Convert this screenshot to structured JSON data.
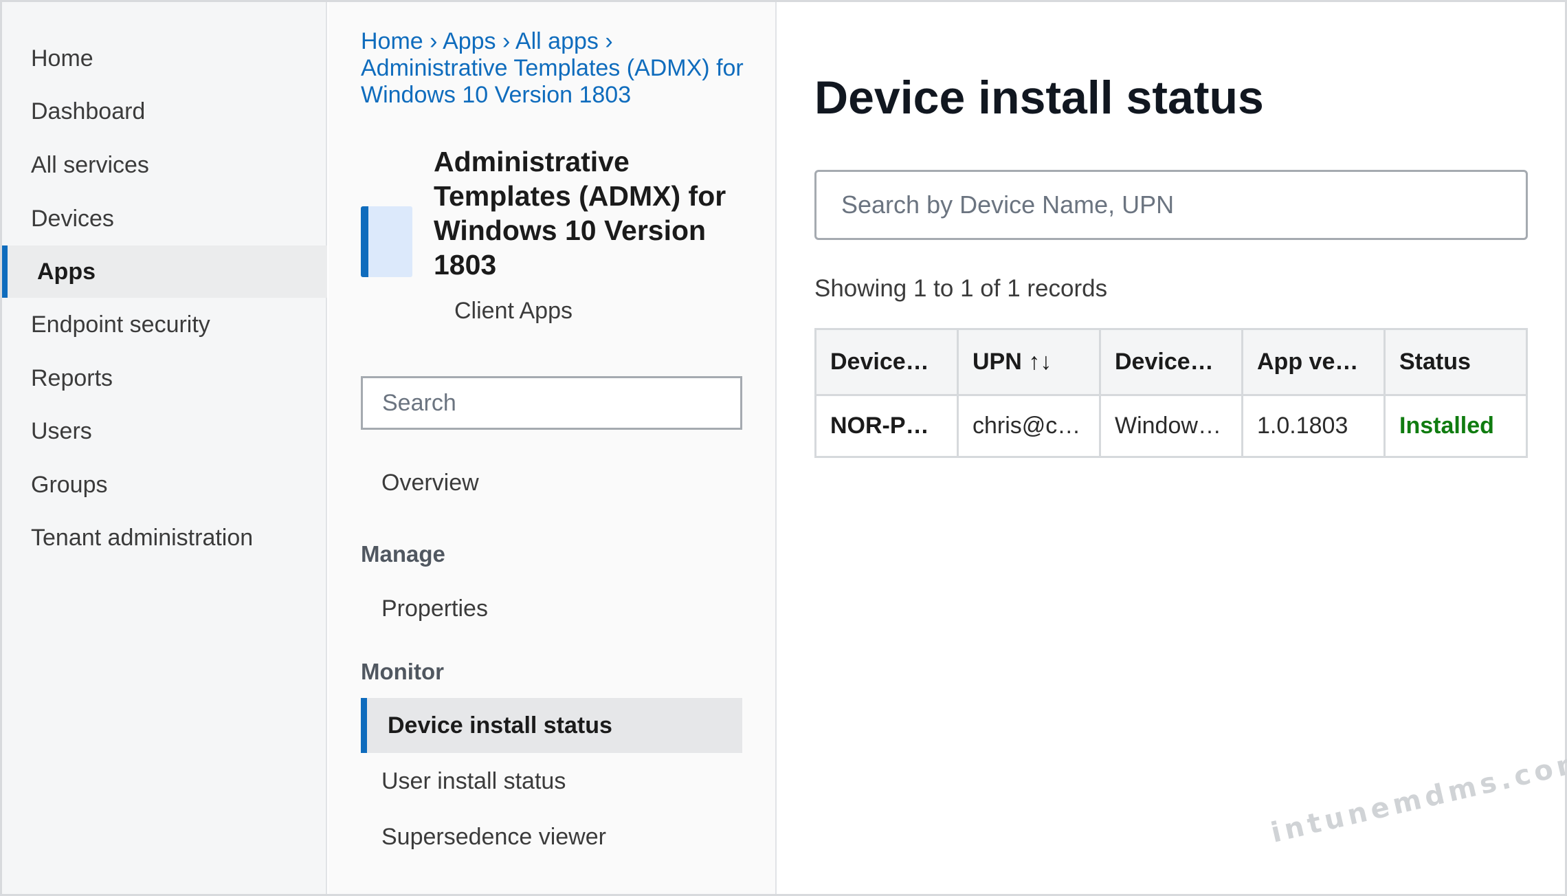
{
  "nav": {
    "items": [
      {
        "label": "Home"
      },
      {
        "label": "Dashboard"
      },
      {
        "label": "All services"
      },
      {
        "label": "Devices"
      },
      {
        "label": "Apps",
        "active": true
      },
      {
        "label": "Endpoint security"
      },
      {
        "label": "Reports"
      },
      {
        "label": "Users"
      },
      {
        "label": "Groups"
      },
      {
        "label": "Tenant administration"
      }
    ]
  },
  "breadcrumb": {
    "items": [
      "Home",
      "Apps",
      "All apps",
      "Administrative Templates (ADMX) for Windows 10 Version 1803"
    ],
    "separator": "›"
  },
  "app": {
    "title": "Administrative Templates (ADMX) for Windows 10 Version 1803",
    "subtitle": "Client Apps",
    "icon": "app-tile-icon"
  },
  "blade": {
    "search_placeholder": "Search",
    "overview": "Overview",
    "manage_header": "Manage",
    "properties": "Properties",
    "monitor_header": "Monitor",
    "device_install_status": "Device install status",
    "user_install_status": "User install status",
    "supersedence_viewer": "Supersedence viewer"
  },
  "main": {
    "title": "Device install status",
    "search_placeholder": "Search by Device Name, UPN",
    "records_text": "Showing 1 to 1 of 1 records",
    "table": {
      "headers": [
        "Device…",
        "UPN ↑↓",
        "Device…",
        "App ve…",
        "Status"
      ],
      "rows": [
        [
          "NOR-PC…",
          "chris@c…",
          "Windows…",
          "1.0.1803",
          "Installed"
        ]
      ]
    }
  },
  "colors": {
    "accent": "#0f6cbd",
    "status_installed": "#107c10"
  },
  "watermark": "intunemdms.com"
}
